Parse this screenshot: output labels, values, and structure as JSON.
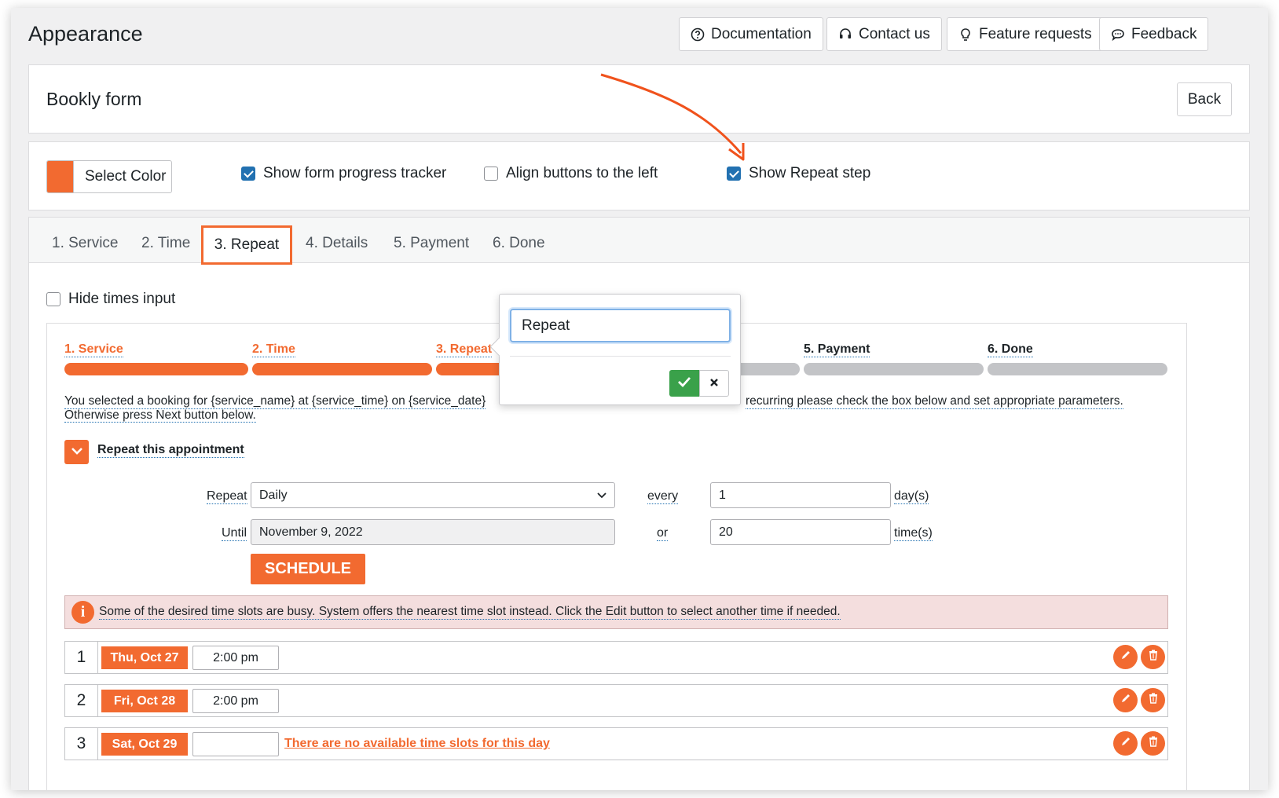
{
  "page": {
    "title": "Appearance"
  },
  "header_buttons": {
    "documentation": "Documentation",
    "contact": "Contact us",
    "features": "Feature requests",
    "feedback": "Feedback"
  },
  "form_panel": {
    "title": "Bookly form",
    "back": "Back"
  },
  "options": {
    "select_color": "Select Color",
    "accent_color": "#f26a30",
    "progress_tracker": "Show form progress tracker",
    "align_left": "Align buttons to the left",
    "show_repeat": "Show Repeat step"
  },
  "tabs": [
    "1. Service",
    "2. Time",
    "3. Repeat",
    "4. Details",
    "5. Payment",
    "6. Done"
  ],
  "hide_times": "Hide times input",
  "steps": [
    "1. Service",
    "2. Time",
    "3. Repeat",
    "5. Payment",
    "6. Done"
  ],
  "info": {
    "line1_left": "You selected a booking for {service_name} at {service_time} on {service_date}",
    "line1_right": "recurring please check the box below and set appropriate parameters.",
    "line2": "Otherwise press Next button below."
  },
  "repeat_section": {
    "label": "Repeat this appointment",
    "repeat_label": "Repeat",
    "repeat_value": "Daily",
    "every_label": "every",
    "every_value": "1",
    "every_unit": "day(s)",
    "until_label": "Until",
    "until_value": "November 9, 2022",
    "or_label": "or",
    "times_value": "20",
    "times_unit": "time(s)",
    "schedule": "SCHEDULE"
  },
  "alert": {
    "icon": "i",
    "text": "Some of the desired time slots are busy. System offers the nearest time slot instead. Click the Edit button to select another time if needed."
  },
  "schedule_rows": [
    {
      "num": "1",
      "date": "Thu, Oct 27",
      "time": "2:00 pm",
      "note": ""
    },
    {
      "num": "2",
      "date": "Fri, Oct 28",
      "time": "2:00 pm",
      "note": ""
    },
    {
      "num": "3",
      "date": "Sat, Oct 29",
      "time": "",
      "note": "There are no available time slots for this day"
    }
  ],
  "popover": {
    "input_value": "Repeat"
  },
  "icons": {
    "documentation": "question-circle-icon",
    "contact": "headset-icon",
    "features": "lightbulb-icon",
    "feedback": "chat-bubble-icon",
    "edit": "pencil-icon",
    "delete": "trash-icon",
    "confirm": "check-icon",
    "cancel": "close-icon"
  }
}
